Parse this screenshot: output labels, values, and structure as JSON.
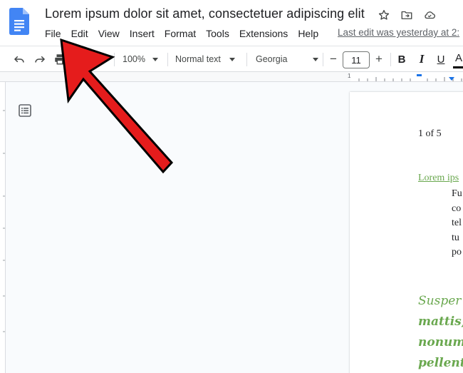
{
  "document": {
    "title": "Lorem ipsum dolor sit amet, consectetuer adipiscing elit",
    "last_edit": "Last edit was yesterday at 2:"
  },
  "menu": {
    "items": [
      "File",
      "Edit",
      "View",
      "Insert",
      "Format",
      "Tools",
      "Extensions",
      "Help"
    ]
  },
  "toolbar": {
    "zoom": "100%",
    "style": "Normal text",
    "font": "Georgia",
    "font_size": "11",
    "decrease": "−",
    "increase": "+",
    "bold": "B",
    "italic": "I",
    "underline": "U",
    "text_color": "A"
  },
  "ruler": {
    "mark": "1"
  },
  "page": {
    "page_number": "1 of 5",
    "link_text": "Lorem ips",
    "body_lines": [
      "Fu",
      "co",
      "tel",
      "tu",
      "po"
    ],
    "green_lines": [
      "Susper",
      "mattis,",
      "nonumr",
      "pellent"
    ]
  },
  "colors": {
    "accent_green": "#6aa84f",
    "docs_blue": "#4285f4",
    "arrow_red": "#e51c1c"
  },
  "icons": [
    "docs-logo-icon",
    "star-icon",
    "move-folder-icon",
    "cloud-status-icon",
    "undo-icon",
    "redo-icon",
    "print-icon",
    "outline-icon"
  ]
}
